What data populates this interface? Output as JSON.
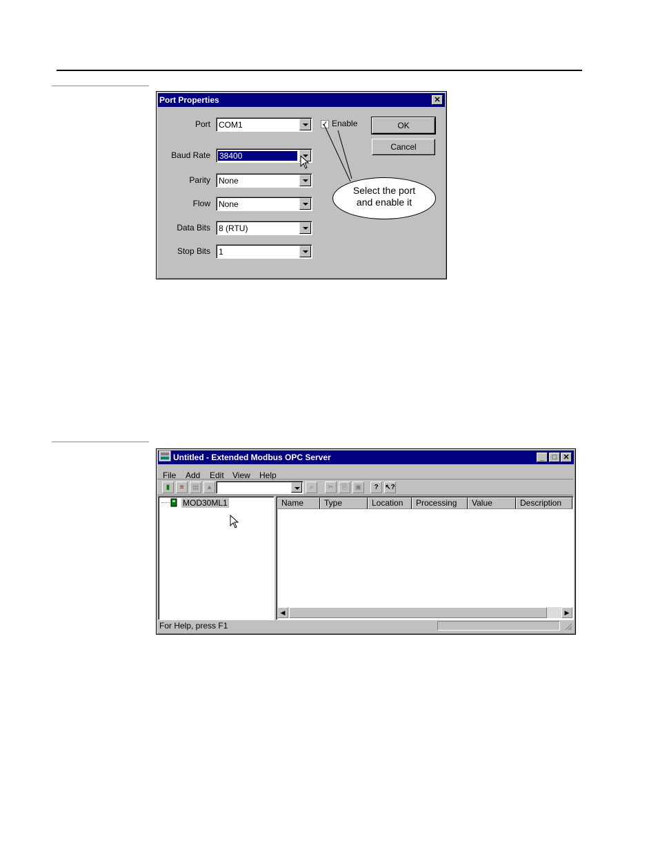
{
  "dialog": {
    "title": "Port Properties",
    "fields": [
      {
        "label": "Port",
        "value": "COM1"
      },
      {
        "label": "Baud Rate",
        "value": "38400"
      },
      {
        "label": "Parity",
        "value": "None"
      },
      {
        "label": "Flow",
        "value": "None"
      },
      {
        "label": "Data Bits",
        "value": "8 (RTU)"
      },
      {
        "label": "Stop Bits",
        "value": "1"
      }
    ],
    "enable_label": "Enable",
    "enable_checked": true,
    "ok_label": "OK",
    "cancel_label": "Cancel",
    "callout_line1": "Select the port",
    "callout_line2": "and enable it"
  },
  "app": {
    "title": "Untitled - Extended Modbus OPC Server",
    "menu": [
      "File",
      "Add",
      "Edit",
      "View",
      "Help"
    ],
    "tree_item": "MOD30ML1",
    "columns": [
      "Name",
      "Type",
      "Location",
      "Processing",
      "Value",
      "Description"
    ],
    "status_text": "For Help, press F1"
  },
  "colors": {
    "titlebar": "#000080",
    "face": "#c0c0c0"
  }
}
